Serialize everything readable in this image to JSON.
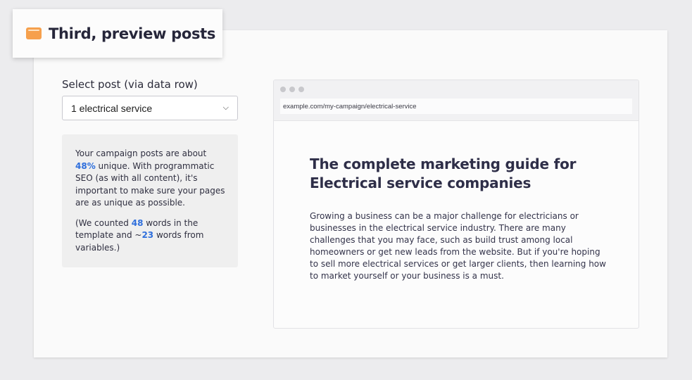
{
  "header": {
    "icon": "folder-icon",
    "title": "Third, preview posts"
  },
  "selector": {
    "label": "Select post (via data row)",
    "selected": "1 electrical service"
  },
  "info": {
    "line1_pre": "Your campaign posts are about ",
    "unique_pct": "48%",
    "line1_post": " unique. With programmatic SEO (as with all content), it's important to make sure your pages are as unique as possible.",
    "counted_pre": "(We counted ",
    "template_words": "48",
    "counted_mid": " words in the template and ~",
    "variable_words": "23",
    "counted_post": " words from variables.)",
    "highlight_color": "#2f6fdc"
  },
  "preview": {
    "url": "example.com/my-campaign/electrical-service",
    "title": "The complete marketing guide for Electrical service companies",
    "body": "Growing a business can be a major challenge for electricians or businesses in the electrical service industry. There are many challenges that you may face, such as build trust among local homeowners or get new leads from the website. But if you're hoping to sell more electrical services or get larger clients, then learning how to market yourself or your business is a must."
  }
}
